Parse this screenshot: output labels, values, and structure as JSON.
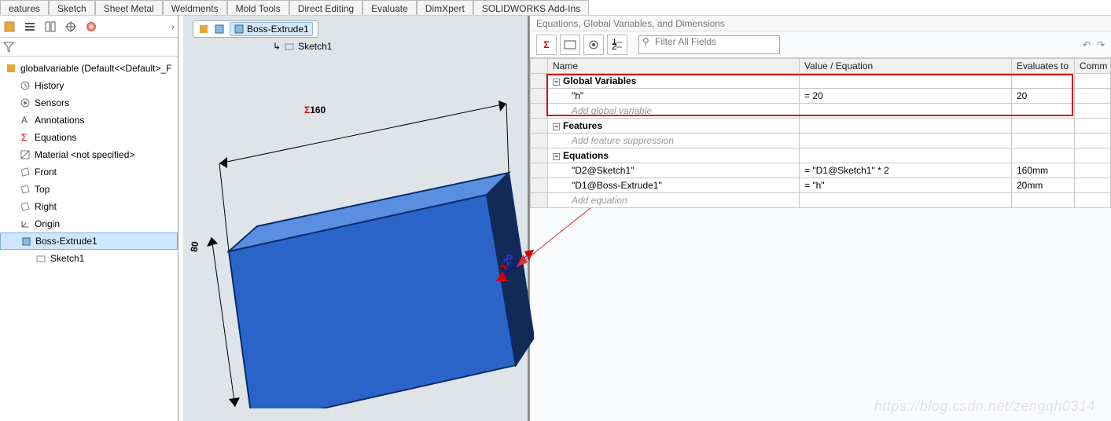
{
  "tabs": [
    "eatures",
    "Sketch",
    "Sheet Metal",
    "Weldments",
    "Mold Tools",
    "Direct Editing",
    "Evaluate",
    "DimXpert",
    "SOLIDWORKS Add-Ins"
  ],
  "tree": {
    "root": "globalvariable  (Default<<Default>_F",
    "history": "History",
    "sensors": "Sensors",
    "annotations": "Annotations",
    "equations": "Equations",
    "material": "Material <not specified>",
    "front": "Front",
    "top": "Top",
    "right": "Right",
    "origin": "Origin",
    "boss": "Boss-Extrude1",
    "sketch": "Sketch1"
  },
  "crumbs": {
    "boss": "Boss-Extrude1",
    "sketch": "Sketch1"
  },
  "dims": {
    "d1": "160",
    "d2": "80",
    "d3": "20"
  },
  "right": {
    "title": "Equations, Global Variables, and Dimensions",
    "filter": "Filter All Fields",
    "headers": [
      "",
      "Name",
      "Value / Equation",
      "Evaluates to",
      "Comm"
    ],
    "sections": {
      "gv": "Global Variables",
      "gv_add": "Add global variable",
      "feat": "Features",
      "feat_add": "Add feature suppression",
      "eq": "Equations",
      "eq_add": "Add equation"
    },
    "rows": {
      "h_name": "\"h\"",
      "h_val": "= 20",
      "h_eval": "20",
      "d2_name": "\"D2@Sketch1\"",
      "d2_val": "= \"D1@Sketch1\" * 2",
      "d2_eval": "160mm",
      "d1_name": "\"D1@Boss-Extrude1\"",
      "d1_val": "= \"h\"",
      "d1_eval": "20mm"
    }
  },
  "watermark": "https://blog.csdn.net/zengqh0314"
}
